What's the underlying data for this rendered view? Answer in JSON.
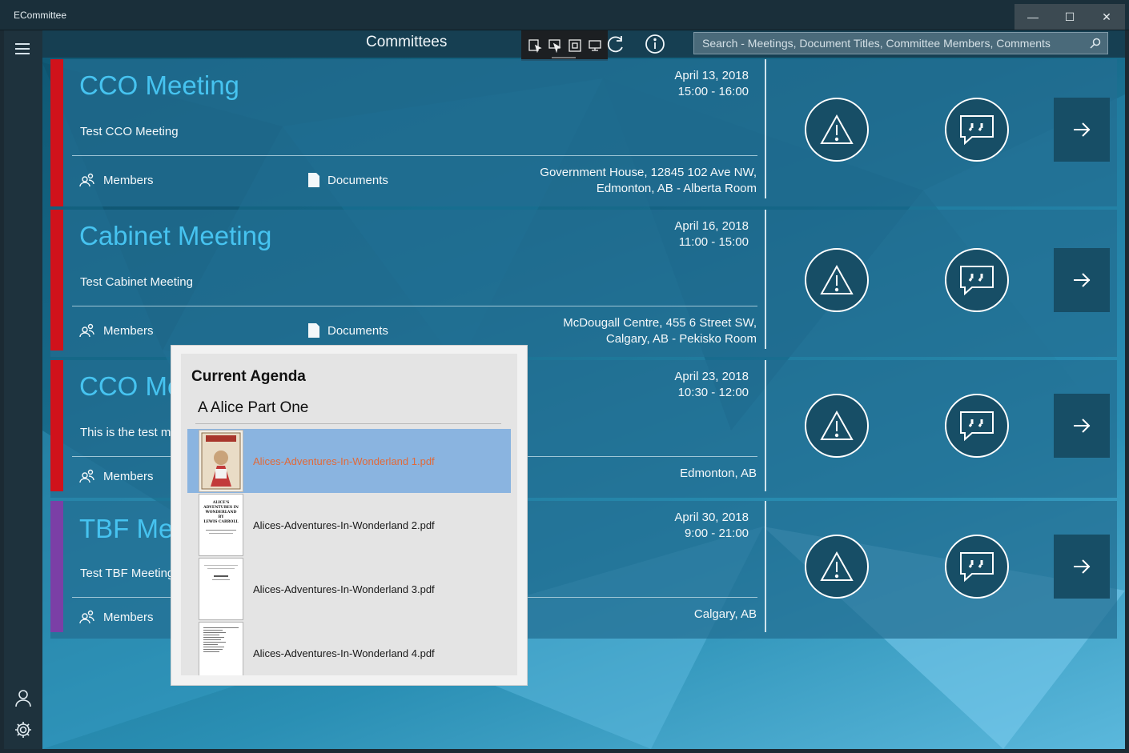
{
  "window": {
    "app_title": "ECommittee",
    "minimize": "—",
    "maximize": "☐",
    "close": "✕"
  },
  "header": {
    "title": "Committees",
    "search_placeholder": "Search - Meetings, Document Titles, Committee Members, Comments"
  },
  "meetings": [
    {
      "title": "CCO Meeting",
      "description": "Test CCO Meeting",
      "date": "April 13, 2018",
      "time": "15:00 - 16:00",
      "location_line1": "Government House, 12845 102 Ave NW,",
      "location_line2": "Edmonton, AB - Alberta Room",
      "members_label": "Members",
      "documents_label": "Documents",
      "accent": "#d0121b"
    },
    {
      "title": "Cabinet Meeting",
      "description": "Test Cabinet Meeting",
      "date": "April 16, 2018",
      "time": "11:00 - 15:00",
      "location_line1": "McDougall Centre, 455 6 Street SW,",
      "location_line2": "Calgary, AB - Pekisko Room",
      "members_label": "Members",
      "documents_label": "Documents",
      "accent": "#d0121b"
    },
    {
      "title": "CCO Me",
      "description": "This is the test m",
      "date": "April 23, 2018",
      "time": "10:30 - 12:00",
      "location_line1": "Edmonton, AB",
      "members_label": "Members",
      "accent": "#d0121b"
    },
    {
      "title": "TBF Mee",
      "description": "Test TBF Meeting",
      "date": "April 30, 2018",
      "time": "9:00 - 21:00",
      "location_line1": "Calgary, AB",
      "members_label": "Members",
      "accent": "#7b3fa6"
    }
  ],
  "agenda": {
    "title": "Current Agenda",
    "section": "A Alice Part One",
    "documents": [
      "Alices-Adventures-In-Wonderland 1.pdf",
      "Alices-Adventures-In-Wonderland 2.pdf",
      "Alices-Adventures-In-Wonderland 3.pdf",
      "Alices-Adventures-In-Wonderland 4.pdf"
    ],
    "thumb2_text": [
      "ALICE'S",
      "ADVENTURES IN",
      "WONDERLAND",
      "BY",
      "LEWIS CARROLL"
    ]
  }
}
